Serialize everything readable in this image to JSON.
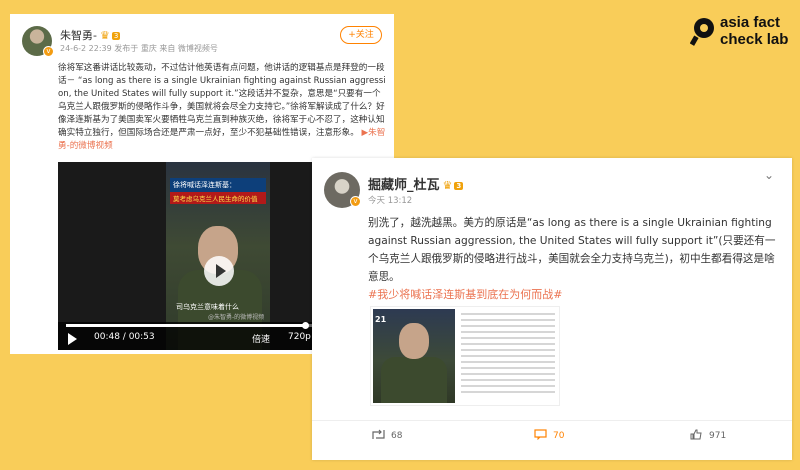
{
  "brand": {
    "line1": "asia fact",
    "line2": "check lab",
    "icon": "magnifier-logo"
  },
  "left_post": {
    "author": "朱智勇-",
    "verified_level": "3",
    "meta": "24-6-2 22:39  发布于 重庆  来自 微博视频号",
    "follow_label": "+关注",
    "body": "徐将军这番讲话比较轰动，不过估计他英语有点问题，他讲话的逻辑基点是拜登的一段话－ “as long as there is a single Ukrainian fighting against Russian aggression, the United States will fully support it.”这段话并不复杂，意思是“只要有一个乌克兰人跟俄罗斯的侵略作斗争，美国就将会尽全力支持它。”徐将军解读成了什么？好像泽连斯基为了美国卖军火要牺牲乌克兰直到种族灭绝，徐将军于心不忍了，这种认知确实特立独行，但国际场合还是严肃一点好，至少不犯基础性错误，注意形象。",
    "source_link": "朱智勇-的微博视频",
    "video": {
      "banner_top": "徐将喊话泽连斯基：",
      "banner_sub": "莫考虑乌克兰人民生命的价值",
      "subtitle": "司乌克兰意味着什么",
      "watermark": "@朱智勇-的微博视频",
      "time": "00:48 / 00:53",
      "progress": 0.906,
      "speed_label": "倍速",
      "quality_label": "720p"
    }
  },
  "right_post": {
    "author": "掘藏师_杜瓦",
    "verified_level": "3",
    "meta": "今天 13:12",
    "body": "别洗了，越洗越黑。美方的原话是“as long as there is a single Ukrainian fighting against Russian aggression, the United States will fully support it”(只要还有一个乌克兰人跟俄罗斯的侵略进行战斗，美国就会全力支持乌克兰)，初中生都看得这是啥意思。",
    "hashtag": "#我少将喊话泽连斯基到底在为何而战#",
    "image_tag": "21",
    "reposts": "68",
    "comments": "70",
    "likes": "971"
  }
}
